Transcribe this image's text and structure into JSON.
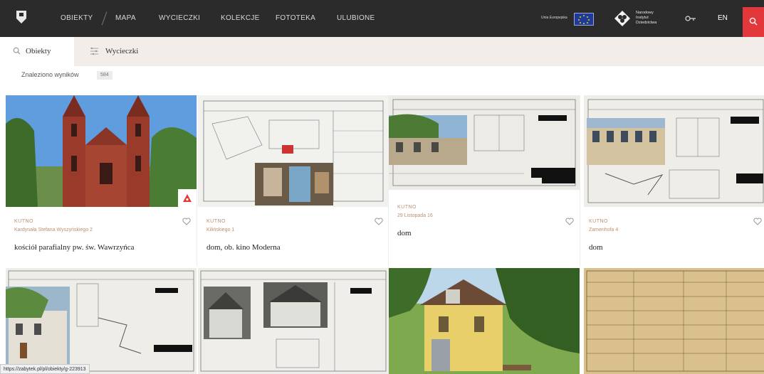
{
  "nav": {
    "items": [
      "OBIEKTY",
      "MAPA",
      "WYCIECZKI",
      "KOLEKCJE",
      "FOTOTEKA",
      "ULUBIONE"
    ],
    "eu_label": "Unia Europejska",
    "institute_lines": [
      "Narodowy",
      "Instytut",
      "Dziedzictwa"
    ],
    "lang": "EN",
    "colors": {
      "bar": "#2b2b2b",
      "search": "#e3383b"
    }
  },
  "tabs": [
    {
      "label": "Obiekty",
      "icon": "search-icon",
      "active": true
    },
    {
      "label": "Wycieczki",
      "icon": "route-icon",
      "active": false
    }
  ],
  "results": {
    "label": "Znaleziono wyników",
    "count": "584"
  },
  "cards": [
    {
      "city": "KUTNO",
      "street": "Kardynała Stefana Wyszyńskiego 2",
      "title": "kościół parafialny pw. św. Wawrzyńca",
      "badge": "heritage-icon"
    },
    {
      "city": "KUTNO",
      "street": "Kilińskiego 1",
      "title": "dom, ob. kino Moderna"
    },
    {
      "city": "KUTNO",
      "street": "29 Listopada 16",
      "title": "dom"
    },
    {
      "city": "KUTNO",
      "street": "Zamenhofa 4",
      "title": "dom"
    }
  ],
  "status_url": "https://zabytek.pl/pl/obiekty/g-223913"
}
